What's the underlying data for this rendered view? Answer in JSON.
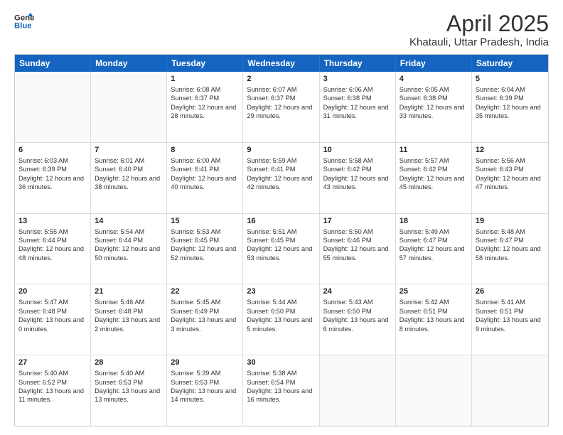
{
  "header": {
    "logo_line1": "General",
    "logo_line2": "Blue",
    "month": "April 2025",
    "location": "Khatauli, Uttar Pradesh, India"
  },
  "days": [
    "Sunday",
    "Monday",
    "Tuesday",
    "Wednesday",
    "Thursday",
    "Friday",
    "Saturday"
  ],
  "weeks": [
    [
      {
        "day": "",
        "empty": true
      },
      {
        "day": "",
        "empty": true
      },
      {
        "day": "1",
        "sunrise": "Sunrise: 6:08 AM",
        "sunset": "Sunset: 6:37 PM",
        "daylight": "Daylight: 12 hours and 28 minutes."
      },
      {
        "day": "2",
        "sunrise": "Sunrise: 6:07 AM",
        "sunset": "Sunset: 6:37 PM",
        "daylight": "Daylight: 12 hours and 29 minutes."
      },
      {
        "day": "3",
        "sunrise": "Sunrise: 6:06 AM",
        "sunset": "Sunset: 6:38 PM",
        "daylight": "Daylight: 12 hours and 31 minutes."
      },
      {
        "day": "4",
        "sunrise": "Sunrise: 6:05 AM",
        "sunset": "Sunset: 6:38 PM",
        "daylight": "Daylight: 12 hours and 33 minutes."
      },
      {
        "day": "5",
        "sunrise": "Sunrise: 6:04 AM",
        "sunset": "Sunset: 6:39 PM",
        "daylight": "Daylight: 12 hours and 35 minutes."
      }
    ],
    [
      {
        "day": "6",
        "sunrise": "Sunrise: 6:03 AM",
        "sunset": "Sunset: 6:39 PM",
        "daylight": "Daylight: 12 hours and 36 minutes."
      },
      {
        "day": "7",
        "sunrise": "Sunrise: 6:01 AM",
        "sunset": "Sunset: 6:40 PM",
        "daylight": "Daylight: 12 hours and 38 minutes."
      },
      {
        "day": "8",
        "sunrise": "Sunrise: 6:00 AM",
        "sunset": "Sunset: 6:41 PM",
        "daylight": "Daylight: 12 hours and 40 minutes."
      },
      {
        "day": "9",
        "sunrise": "Sunrise: 5:59 AM",
        "sunset": "Sunset: 6:41 PM",
        "daylight": "Daylight: 12 hours and 42 minutes."
      },
      {
        "day": "10",
        "sunrise": "Sunrise: 5:58 AM",
        "sunset": "Sunset: 6:42 PM",
        "daylight": "Daylight: 12 hours and 43 minutes."
      },
      {
        "day": "11",
        "sunrise": "Sunrise: 5:57 AM",
        "sunset": "Sunset: 6:42 PM",
        "daylight": "Daylight: 12 hours and 45 minutes."
      },
      {
        "day": "12",
        "sunrise": "Sunrise: 5:56 AM",
        "sunset": "Sunset: 6:43 PM",
        "daylight": "Daylight: 12 hours and 47 minutes."
      }
    ],
    [
      {
        "day": "13",
        "sunrise": "Sunrise: 5:55 AM",
        "sunset": "Sunset: 6:44 PM",
        "daylight": "Daylight: 12 hours and 48 minutes."
      },
      {
        "day": "14",
        "sunrise": "Sunrise: 5:54 AM",
        "sunset": "Sunset: 6:44 PM",
        "daylight": "Daylight: 12 hours and 50 minutes."
      },
      {
        "day": "15",
        "sunrise": "Sunrise: 5:53 AM",
        "sunset": "Sunset: 6:45 PM",
        "daylight": "Daylight: 12 hours and 52 minutes."
      },
      {
        "day": "16",
        "sunrise": "Sunrise: 5:51 AM",
        "sunset": "Sunset: 6:45 PM",
        "daylight": "Daylight: 12 hours and 53 minutes."
      },
      {
        "day": "17",
        "sunrise": "Sunrise: 5:50 AM",
        "sunset": "Sunset: 6:46 PM",
        "daylight": "Daylight: 12 hours and 55 minutes."
      },
      {
        "day": "18",
        "sunrise": "Sunrise: 5:49 AM",
        "sunset": "Sunset: 6:47 PM",
        "daylight": "Daylight: 12 hours and 57 minutes."
      },
      {
        "day": "19",
        "sunrise": "Sunrise: 5:48 AM",
        "sunset": "Sunset: 6:47 PM",
        "daylight": "Daylight: 12 hours and 58 minutes."
      }
    ],
    [
      {
        "day": "20",
        "sunrise": "Sunrise: 5:47 AM",
        "sunset": "Sunset: 6:48 PM",
        "daylight": "Daylight: 13 hours and 0 minutes."
      },
      {
        "day": "21",
        "sunrise": "Sunrise: 5:46 AM",
        "sunset": "Sunset: 6:48 PM",
        "daylight": "Daylight: 13 hours and 2 minutes."
      },
      {
        "day": "22",
        "sunrise": "Sunrise: 5:45 AM",
        "sunset": "Sunset: 6:49 PM",
        "daylight": "Daylight: 13 hours and 3 minutes."
      },
      {
        "day": "23",
        "sunrise": "Sunrise: 5:44 AM",
        "sunset": "Sunset: 6:50 PM",
        "daylight": "Daylight: 13 hours and 5 minutes."
      },
      {
        "day": "24",
        "sunrise": "Sunrise: 5:43 AM",
        "sunset": "Sunset: 6:50 PM",
        "daylight": "Daylight: 13 hours and 6 minutes."
      },
      {
        "day": "25",
        "sunrise": "Sunrise: 5:42 AM",
        "sunset": "Sunset: 6:51 PM",
        "daylight": "Daylight: 13 hours and 8 minutes."
      },
      {
        "day": "26",
        "sunrise": "Sunrise: 5:41 AM",
        "sunset": "Sunset: 6:51 PM",
        "daylight": "Daylight: 13 hours and 9 minutes."
      }
    ],
    [
      {
        "day": "27",
        "sunrise": "Sunrise: 5:40 AM",
        "sunset": "Sunset: 6:52 PM",
        "daylight": "Daylight: 13 hours and 11 minutes."
      },
      {
        "day": "28",
        "sunrise": "Sunrise: 5:40 AM",
        "sunset": "Sunset: 6:53 PM",
        "daylight": "Daylight: 13 hours and 13 minutes."
      },
      {
        "day": "29",
        "sunrise": "Sunrise: 5:39 AM",
        "sunset": "Sunset: 6:53 PM",
        "daylight": "Daylight: 13 hours and 14 minutes."
      },
      {
        "day": "30",
        "sunrise": "Sunrise: 5:38 AM",
        "sunset": "Sunset: 6:54 PM",
        "daylight": "Daylight: 13 hours and 16 minutes."
      },
      {
        "day": "",
        "empty": true
      },
      {
        "day": "",
        "empty": true
      },
      {
        "day": "",
        "empty": true
      }
    ]
  ]
}
